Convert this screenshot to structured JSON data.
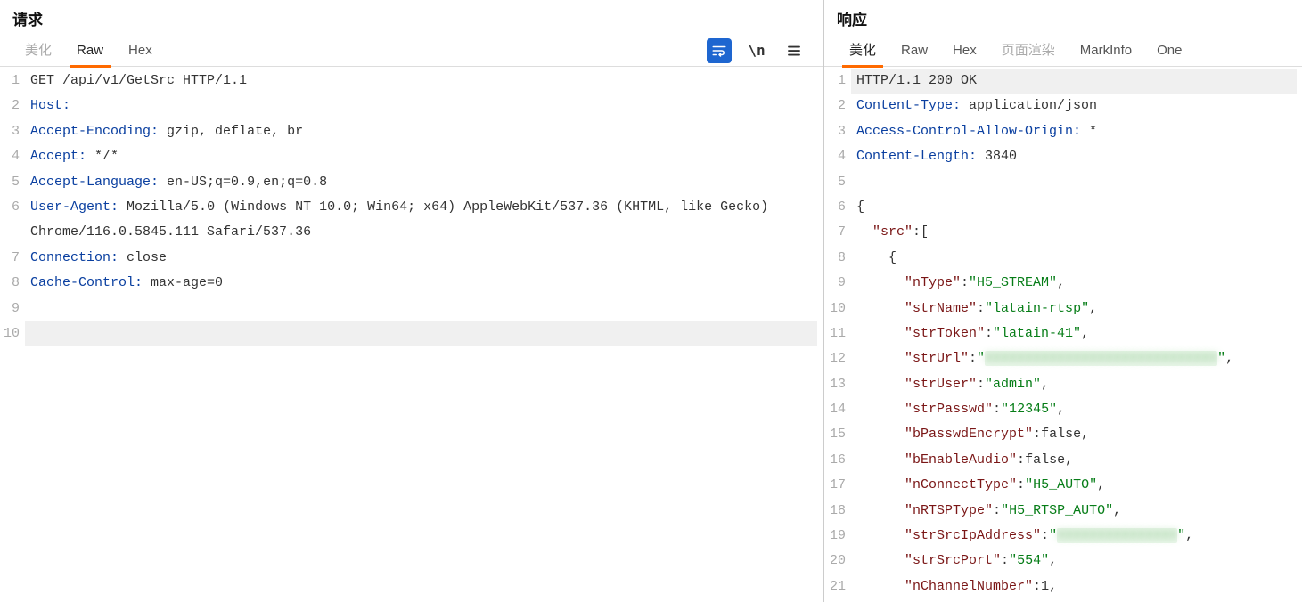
{
  "request": {
    "title": "请求",
    "tabs": {
      "beautify": "美化",
      "raw": "Raw",
      "hex": "Hex"
    },
    "lines": [
      {
        "kind": "plain",
        "text": "GET /api/v1/GetSrc HTTP/1.1"
      },
      {
        "kind": "hdr",
        "key": "Host:",
        "val": ""
      },
      {
        "kind": "hdr",
        "key": "Accept-Encoding:",
        "val": " gzip, deflate, br"
      },
      {
        "kind": "hdr",
        "key": "Accept:",
        "val": " */*"
      },
      {
        "kind": "hdr",
        "key": "Accept-Language:",
        "val": " en-US;q=0.9,en;q=0.8"
      },
      {
        "kind": "hdr",
        "key": "User-Agent:",
        "val": " Mozilla/5.0 (Windows NT 10.0; Win64; x64) AppleWebKit/537.36 (KHTML, like Gecko) Chrome/116.0.5845.111 Safari/537.36",
        "wrap": true
      },
      {
        "kind": "hdr",
        "key": "Connection:",
        "val": " close"
      },
      {
        "kind": "hdr",
        "key": "Cache-Control:",
        "val": " max-age=0"
      },
      {
        "kind": "plain",
        "text": ""
      },
      {
        "kind": "plain",
        "text": "",
        "hl": true
      }
    ],
    "icons": {
      "wrap": "word-wrap-icon",
      "newline": "newline-icon",
      "menu": "hamburger-icon"
    },
    "newline_text": "\\n"
  },
  "response": {
    "title": "响应",
    "tabs": {
      "beautify": "美化",
      "raw": "Raw",
      "hex": "Hex",
      "render": "页面渲染",
      "markinfo": "MarkInfo",
      "one": "One"
    },
    "lines": [
      {
        "kind": "plain",
        "text": "HTTP/1.1 200 OK",
        "hl": true
      },
      {
        "kind": "hdr",
        "key": "Content-Type:",
        "val": " application/json"
      },
      {
        "kind": "hdr",
        "key": "Access-Control-Allow-Origin:",
        "val": " *"
      },
      {
        "kind": "hdr",
        "key": "Content-Length:",
        "val": " 3840"
      },
      {
        "kind": "plain",
        "text": ""
      },
      {
        "kind": "plain",
        "text": "{"
      },
      {
        "kind": "jarr",
        "indent": "  ",
        "key": "\"src\"",
        "sep": ":["
      },
      {
        "kind": "plain",
        "text": "    {"
      },
      {
        "kind": "jkv",
        "indent": "      ",
        "key": "\"nType\"",
        "sep": ":",
        "val": "\"H5_STREAM\"",
        "tail": ","
      },
      {
        "kind": "jkv",
        "indent": "      ",
        "key": "\"strName\"",
        "sep": ":",
        "val": "\"latain-rtsp\"",
        "tail": ","
      },
      {
        "kind": "jkv",
        "indent": "      ",
        "key": "\"strToken\"",
        "sep": ":",
        "val": "\"latain-41\"",
        "tail": ","
      },
      {
        "kind": "jkv_blur",
        "indent": "      ",
        "key": "\"strUrl\"",
        "sep": ":",
        "pre": "\"",
        "blur": "XXXXXXXXXXXXXXXXXXXXXXXXXXXXX",
        "post": "\"",
        "tail": ","
      },
      {
        "kind": "jkv",
        "indent": "      ",
        "key": "\"strUser\"",
        "sep": ":",
        "val": "\"admin\"",
        "tail": ","
      },
      {
        "kind": "jkv",
        "indent": "      ",
        "key": "\"strPasswd\"",
        "sep": ":",
        "val": "\"12345\"",
        "tail": ","
      },
      {
        "kind": "jkb",
        "indent": "      ",
        "key": "\"bPasswdEncrypt\"",
        "sep": ":",
        "bval": "false",
        "tail": ","
      },
      {
        "kind": "jkb",
        "indent": "      ",
        "key": "\"bEnableAudio\"",
        "sep": ":",
        "bval": "false",
        "tail": ","
      },
      {
        "kind": "jkv",
        "indent": "      ",
        "key": "\"nConnectType\"",
        "sep": ":",
        "val": "\"H5_AUTO\"",
        "tail": ","
      },
      {
        "kind": "jkv",
        "indent": "      ",
        "key": "\"nRTSPType\"",
        "sep": ":",
        "val": "\"H5_RTSP_AUTO\"",
        "tail": ","
      },
      {
        "kind": "jkv_blur",
        "indent": "      ",
        "key": "\"strSrcIpAddress\"",
        "sep": ":",
        "pre": "\"",
        "blur": "XXXXXXXXXXXXXXX",
        "post": "\"",
        "tail": ","
      },
      {
        "kind": "jkv",
        "indent": "      ",
        "key": "\"strSrcPort\"",
        "sep": ":",
        "val": "\"554\"",
        "tail": ","
      },
      {
        "kind": "jkb",
        "indent": "      ",
        "key": "\"nChannelNumber\"",
        "sep": ":",
        "bval": "1",
        "tail": ","
      }
    ]
  }
}
